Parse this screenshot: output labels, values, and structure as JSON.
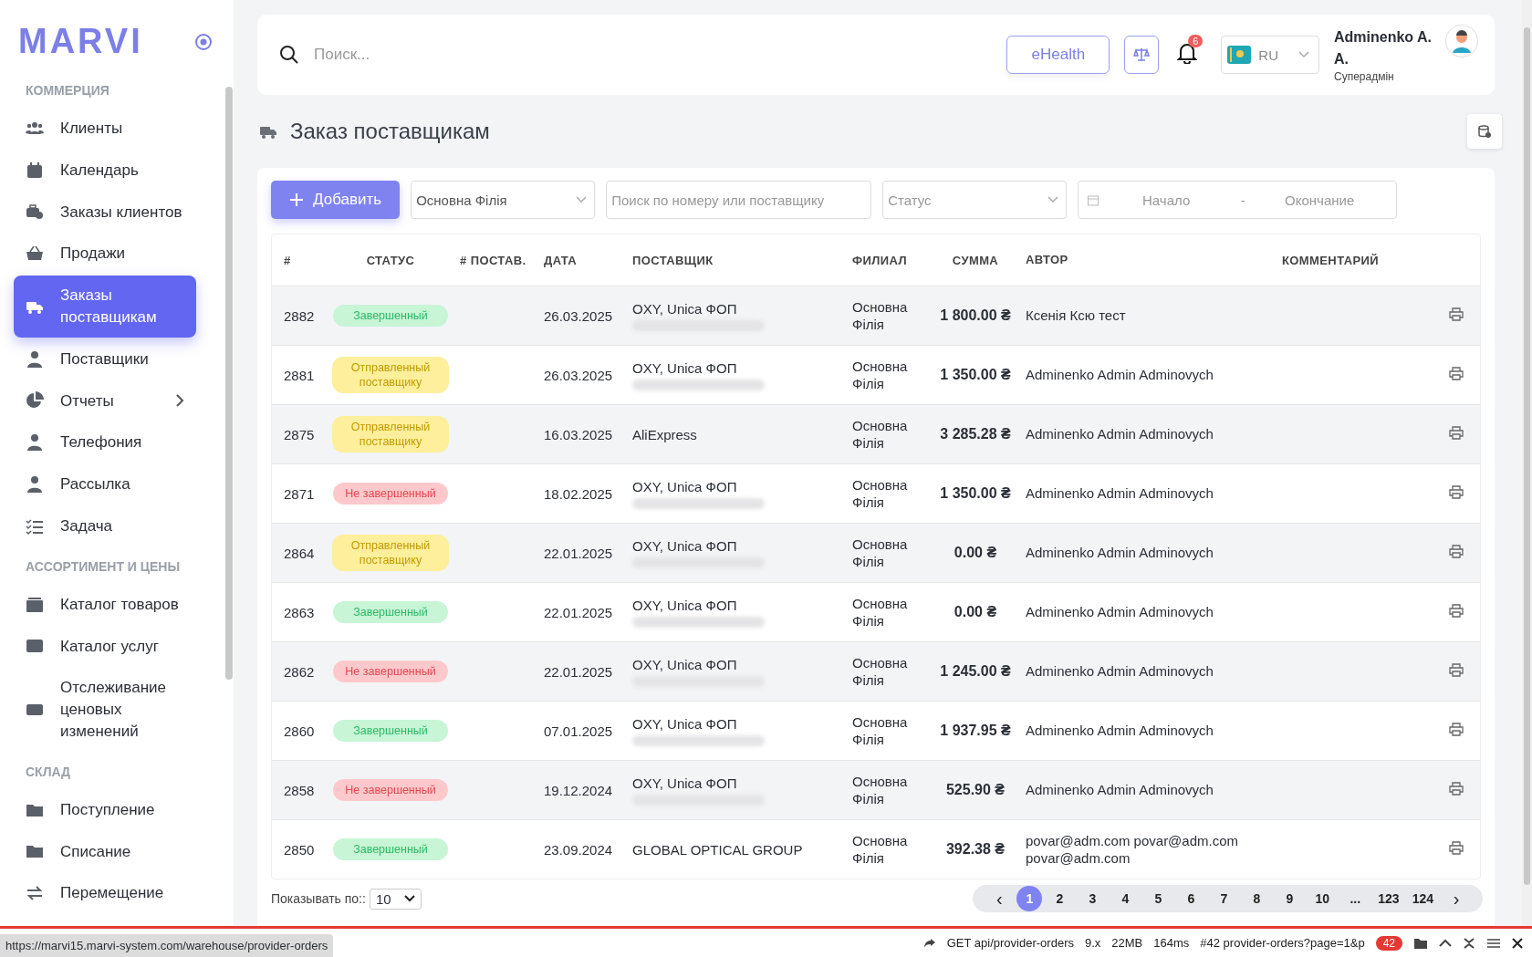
{
  "sidebar": {
    "logo": "MARVI",
    "sections": [
      {
        "title": "КОММЕРЦИЯ",
        "items": [
          {
            "label": "Клиенты",
            "selected": false,
            "has_submenu": false
          },
          {
            "label": "Календарь",
            "selected": false,
            "has_submenu": false
          },
          {
            "label": "Заказы клиентов",
            "selected": false,
            "has_submenu": false
          },
          {
            "label": "Продажи",
            "selected": false,
            "has_submenu": false
          },
          {
            "label": "Заказы поставщикам",
            "selected": true,
            "has_submenu": false
          },
          {
            "label": "Поставщики",
            "selected": false,
            "has_submenu": false
          },
          {
            "label": "Отчеты",
            "selected": false,
            "has_submenu": true
          },
          {
            "label": "Телефония",
            "selected": false,
            "has_submenu": false
          },
          {
            "label": "Рассылка",
            "selected": false,
            "has_submenu": false
          },
          {
            "label": "Задача",
            "selected": false,
            "has_submenu": false
          }
        ]
      },
      {
        "title": "АССОРТИМЕНТ И ЦЕНЫ",
        "items": [
          {
            "label": "Каталог товаров",
            "selected": false,
            "has_submenu": false
          },
          {
            "label": "Каталог услуг",
            "selected": false,
            "has_submenu": false
          },
          {
            "label": "Отслеживание ценовых изменений",
            "selected": false,
            "has_submenu": false
          }
        ]
      },
      {
        "title": "СКЛАД",
        "items": [
          {
            "label": "Поступление",
            "selected": false,
            "has_submenu": false
          },
          {
            "label": "Списание",
            "selected": false,
            "has_submenu": false
          },
          {
            "label": "Перемещение",
            "selected": false,
            "has_submenu": false
          }
        ]
      }
    ]
  },
  "topbar": {
    "search_placeholder": "Поиск...",
    "ehealth_button": "eHealth",
    "notifications_count": "6",
    "language": "RU",
    "user_name": "Adminenko A. A.",
    "user_role": "Суперадмін"
  },
  "page": {
    "title": "Заказ поставщикам"
  },
  "filters": {
    "add_button": "Добавить",
    "branch": "Основна Філія",
    "search_placeholder": "Поиск по номеру или поставщику",
    "status_placeholder": "Статус",
    "date_start_placeholder": "Начало",
    "date_separator": "-",
    "date_end_placeholder": "Окончание"
  },
  "table": {
    "columns": [
      "#",
      "СТАТУС",
      "# ПОСТАВ.",
      "ДАТА",
      "ПОСТАВЩИК",
      "ФИЛИАЛ",
      "СУММА",
      "АВТОР",
      "КОММЕНТАРИЙ"
    ],
    "rows": [
      {
        "number": "2882",
        "status": "Завершенный",
        "kind": "completed",
        "date": "26.03.2025",
        "supplier": "OXY, Unica ФОП",
        "supplier_redacted": true,
        "branch": "Основна Філія",
        "sum": "1 800.00 ₴",
        "author": "Ксенія Ксю тест"
      },
      {
        "number": "2881",
        "status": "Отправленный поставщику",
        "kind": "sent",
        "date": "26.03.2025",
        "supplier": "OXY, Unica ФОП",
        "supplier_redacted": true,
        "branch": "Основна Філія",
        "sum": "1 350.00 ₴",
        "author": "Adminenko Admin Adminovych"
      },
      {
        "number": "2875",
        "status": "Отправленный поставщику",
        "kind": "sent",
        "date": "16.03.2025",
        "supplier": "AliExpress",
        "supplier_redacted": false,
        "branch": "Основна Філія",
        "sum": "3 285.28 ₴",
        "author": "Adminenko Admin Adminovych"
      },
      {
        "number": "2871",
        "status": "Не завершенный",
        "kind": "not_completed",
        "date": "18.02.2025",
        "supplier": "OXY, Unica ФОП",
        "supplier_redacted": true,
        "branch": "Основна Філія",
        "sum": "1 350.00 ₴",
        "author": "Adminenko Admin Adminovych"
      },
      {
        "number": "2864",
        "status": "Отправленный поставщику",
        "kind": "sent",
        "date": "22.01.2025",
        "supplier": "OXY, Unica ФОП",
        "supplier_redacted": true,
        "branch": "Основна Філія",
        "sum": "0.00 ₴",
        "author": "Adminenko Admin Adminovych"
      },
      {
        "number": "2863",
        "status": "Завершенный",
        "kind": "completed",
        "date": "22.01.2025",
        "supplier": "OXY, Unica ФОП",
        "supplier_redacted": true,
        "branch": "Основна Філія",
        "sum": "0.00 ₴",
        "author": "Adminenko Admin Adminovych"
      },
      {
        "number": "2862",
        "status": "Не завершенный",
        "kind": "not_completed",
        "date": "22.01.2025",
        "supplier": "OXY, Unica ФОП",
        "supplier_redacted": true,
        "branch": "Основна Філія",
        "sum": "1 245.00 ₴",
        "author": "Adminenko Admin Adminovych"
      },
      {
        "number": "2860",
        "status": "Завершенный",
        "kind": "completed",
        "date": "07.01.2025",
        "supplier": "OXY, Unica ФОП",
        "supplier_redacted": true,
        "branch": "Основна Філія",
        "sum": "1 937.95 ₴",
        "author": "Adminenko Admin Adminovych"
      },
      {
        "number": "2858",
        "status": "Не завершенный",
        "kind": "not_completed",
        "date": "19.12.2024",
        "supplier": "OXY, Unica ФОП",
        "supplier_redacted": true,
        "branch": "Основна Філія",
        "sum": "525.90 ₴",
        "author": "Adminenko Admin Adminovych"
      },
      {
        "number": "2850",
        "status": "Завершенный",
        "kind": "completed",
        "date": "23.09.2024",
        "supplier": "GLOBAL OPTICAL GROUP",
        "supplier_redacted": false,
        "branch": "Основна Філія",
        "sum": "392.38 ₴",
        "author": "povar@adm.com povar@adm.com povar@adm.com"
      }
    ]
  },
  "pagination": {
    "per_page_label": "Показывать по::",
    "per_page": "10",
    "prev": "‹",
    "next": "›",
    "pages": [
      {
        "label": "1",
        "selected": true
      },
      {
        "label": "2",
        "selected": false
      },
      {
        "label": "3",
        "selected": false
      },
      {
        "label": "4",
        "selected": false
      },
      {
        "label": "5",
        "selected": false
      },
      {
        "label": "6",
        "selected": false
      },
      {
        "label": "7",
        "selected": false
      },
      {
        "label": "8",
        "selected": false
      },
      {
        "label": "9",
        "selected": false
      },
      {
        "label": "10",
        "selected": false
      },
      {
        "label": "...",
        "selected": false
      },
      {
        "label": "123",
        "selected": false
      },
      {
        "label": "124",
        "selected": false
      }
    ]
  },
  "debug_bar": {
    "request": "GET api/provider-orders",
    "version": "9.x",
    "memory": "22MB",
    "time": "164ms",
    "route": "#42 provider-orders?page=1&p",
    "history_count": "42"
  },
  "status_url": "https://marvi15.marvi-system.com/warehouse/provider-orders"
}
